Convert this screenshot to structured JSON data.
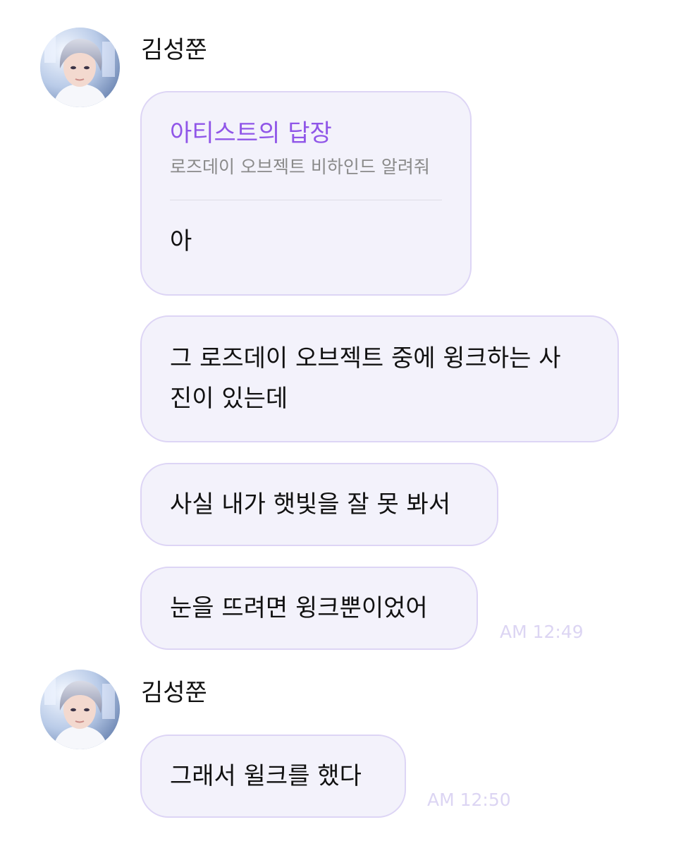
{
  "colors": {
    "bubble_background": "#f3f2fb",
    "bubble_border": "#ddd5f5",
    "reply_title": "#9056e8",
    "reply_subtitle": "#8a8a8a",
    "timestamp": "#dcd5f3",
    "text": "#111111"
  },
  "groups": [
    {
      "sender": "김성쭌",
      "avatar_icon": "profile-photo-avatar",
      "messages": [
        {
          "type": "artist-reply",
          "reply_title": "아티스트의 답장",
          "reply_quote": "로즈데이 오브젝트 비하인드 알려줘",
          "text": "아"
        },
        {
          "type": "text",
          "text": "그 로즈데이 오브젝트 중에 윙크하는 사\n진이 있는데"
        },
        {
          "type": "text",
          "text": "사실 내가 햇빛을 잘 못 봐서"
        },
        {
          "type": "text",
          "text": "눈을 뜨려면 윙크뿐이었어"
        }
      ],
      "timestamp": "AM 12:49"
    },
    {
      "sender": "김성쭌",
      "avatar_icon": "profile-photo-avatar",
      "messages": [
        {
          "type": "text",
          "text": "그래서 윌크를 했다"
        }
      ],
      "timestamp": "AM 12:50"
    }
  ]
}
